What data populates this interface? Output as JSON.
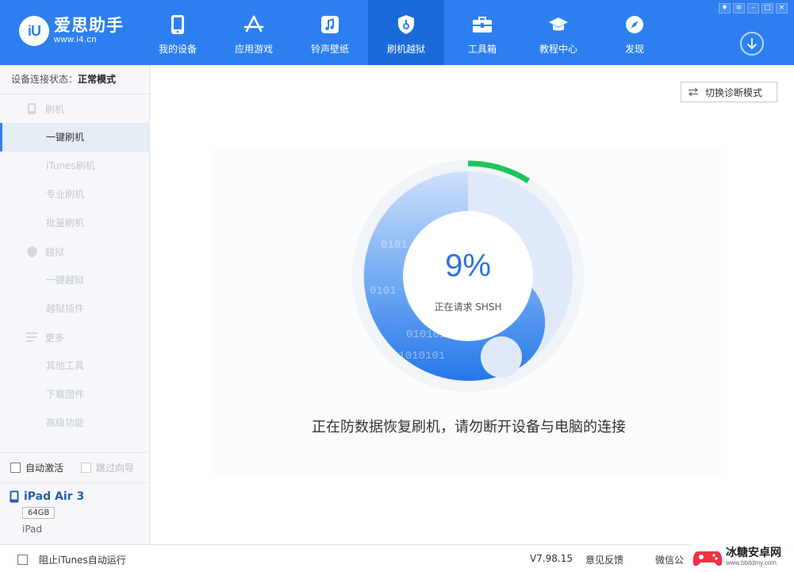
{
  "app": {
    "logo_mark": "iU",
    "name": "爱思助手",
    "url": "www.i4.cn"
  },
  "nav": [
    {
      "label": "我的设备",
      "icon": "tablet-icon"
    },
    {
      "label": "应用游戏",
      "icon": "app-store-icon"
    },
    {
      "label": "铃声壁纸",
      "icon": "music-note-icon"
    },
    {
      "label": "刷机越狱",
      "icon": "shield-key-icon",
      "active": true
    },
    {
      "label": "工具箱",
      "icon": "toolbox-icon"
    },
    {
      "label": "教程中心",
      "icon": "graduation-cap-icon"
    },
    {
      "label": "发现",
      "icon": "compass-icon"
    }
  ],
  "window_controls": [
    "shirt-icon",
    "menu-icon",
    "minimize-icon",
    "maximize-icon",
    "close-icon"
  ],
  "sidebar": {
    "status_label": "设备连接状态：",
    "status_value": "正常模式",
    "sections": [
      {
        "title": "刷机",
        "icon": "phone-icon",
        "items": [
          "一键刷机",
          "iTunes刷机",
          "专业刷机",
          "批量刷机"
        ]
      },
      {
        "title": "越狱",
        "icon": "shield-icon",
        "items": [
          "一键越狱",
          "越狱插件"
        ]
      },
      {
        "title": "更多",
        "icon": "list-icon",
        "items": [
          "其他工具",
          "下载固件",
          "高级功能"
        ]
      }
    ],
    "active_item": "一键刷机",
    "auto_activate": "自动激活",
    "skip_guide": "跳过向导",
    "device": {
      "name": "iPad Air 3",
      "capacity": "64GB",
      "type": "iPad"
    }
  },
  "main": {
    "diagnose_button": "切换诊断模式",
    "progress_percent": 9,
    "progress_text": "9%",
    "progress_status": "正在请求 SHSH",
    "warning": "正在防数据恢复刷机，请勿断开设备与电脑的连接",
    "colors": {
      "accent": "#2d7ff0",
      "progress": "#1fc45a",
      "ring": "#2f86ec"
    }
  },
  "statusbar": {
    "block_itunes": "阻止iTunes自动运行",
    "version": "V7.98.15",
    "feedback": "意见反馈",
    "wechat": "微信公"
  },
  "watermark": {
    "name": "冰糖安卓网",
    "url": "www.btxtdmy.com"
  }
}
